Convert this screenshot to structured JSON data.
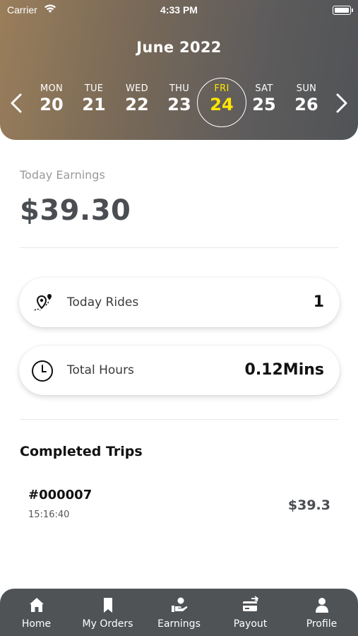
{
  "status_bar": {
    "carrier": "Carrier",
    "time": "4:33 PM"
  },
  "calendar": {
    "month": "June 2022",
    "days": [
      {
        "name": "MON",
        "num": "20"
      },
      {
        "name": "TUE",
        "num": "21"
      },
      {
        "name": "WED",
        "num": "22"
      },
      {
        "name": "THU",
        "num": "23"
      },
      {
        "name": "FRI",
        "num": "24"
      },
      {
        "name": "SAT",
        "num": "25"
      },
      {
        "name": "SUN",
        "num": "26"
      }
    ],
    "selected_day": "FRI 24",
    "selected_color": "#ffe600"
  },
  "earnings": {
    "label": "Today Earnings",
    "value": "$39.30"
  },
  "stats": {
    "rides": {
      "label": "Today Rides",
      "value": "1",
      "icon": "route-pin-icon"
    },
    "hours": {
      "label": "Total Hours",
      "value": "0.12Mins",
      "icon": "clock-icon"
    }
  },
  "completed": {
    "title": "Completed Trips",
    "trips": [
      {
        "id": "#000007",
        "time": "15:16:40",
        "amount": "$39.3"
      }
    ]
  },
  "tabbar": {
    "items": [
      {
        "label": "Home",
        "icon": "home-icon"
      },
      {
        "label": "My Orders",
        "icon": "bookmark-icon"
      },
      {
        "label": "Earnings",
        "icon": "earnings-hand-icon"
      },
      {
        "label": "Payout",
        "icon": "payout-card-icon"
      },
      {
        "label": "Profile",
        "icon": "profile-icon"
      }
    ]
  },
  "colors": {
    "header_start": "#9a7e5a",
    "header_end": "#505356",
    "tabbar": "#505356",
    "value_text": "#4a4d52"
  }
}
